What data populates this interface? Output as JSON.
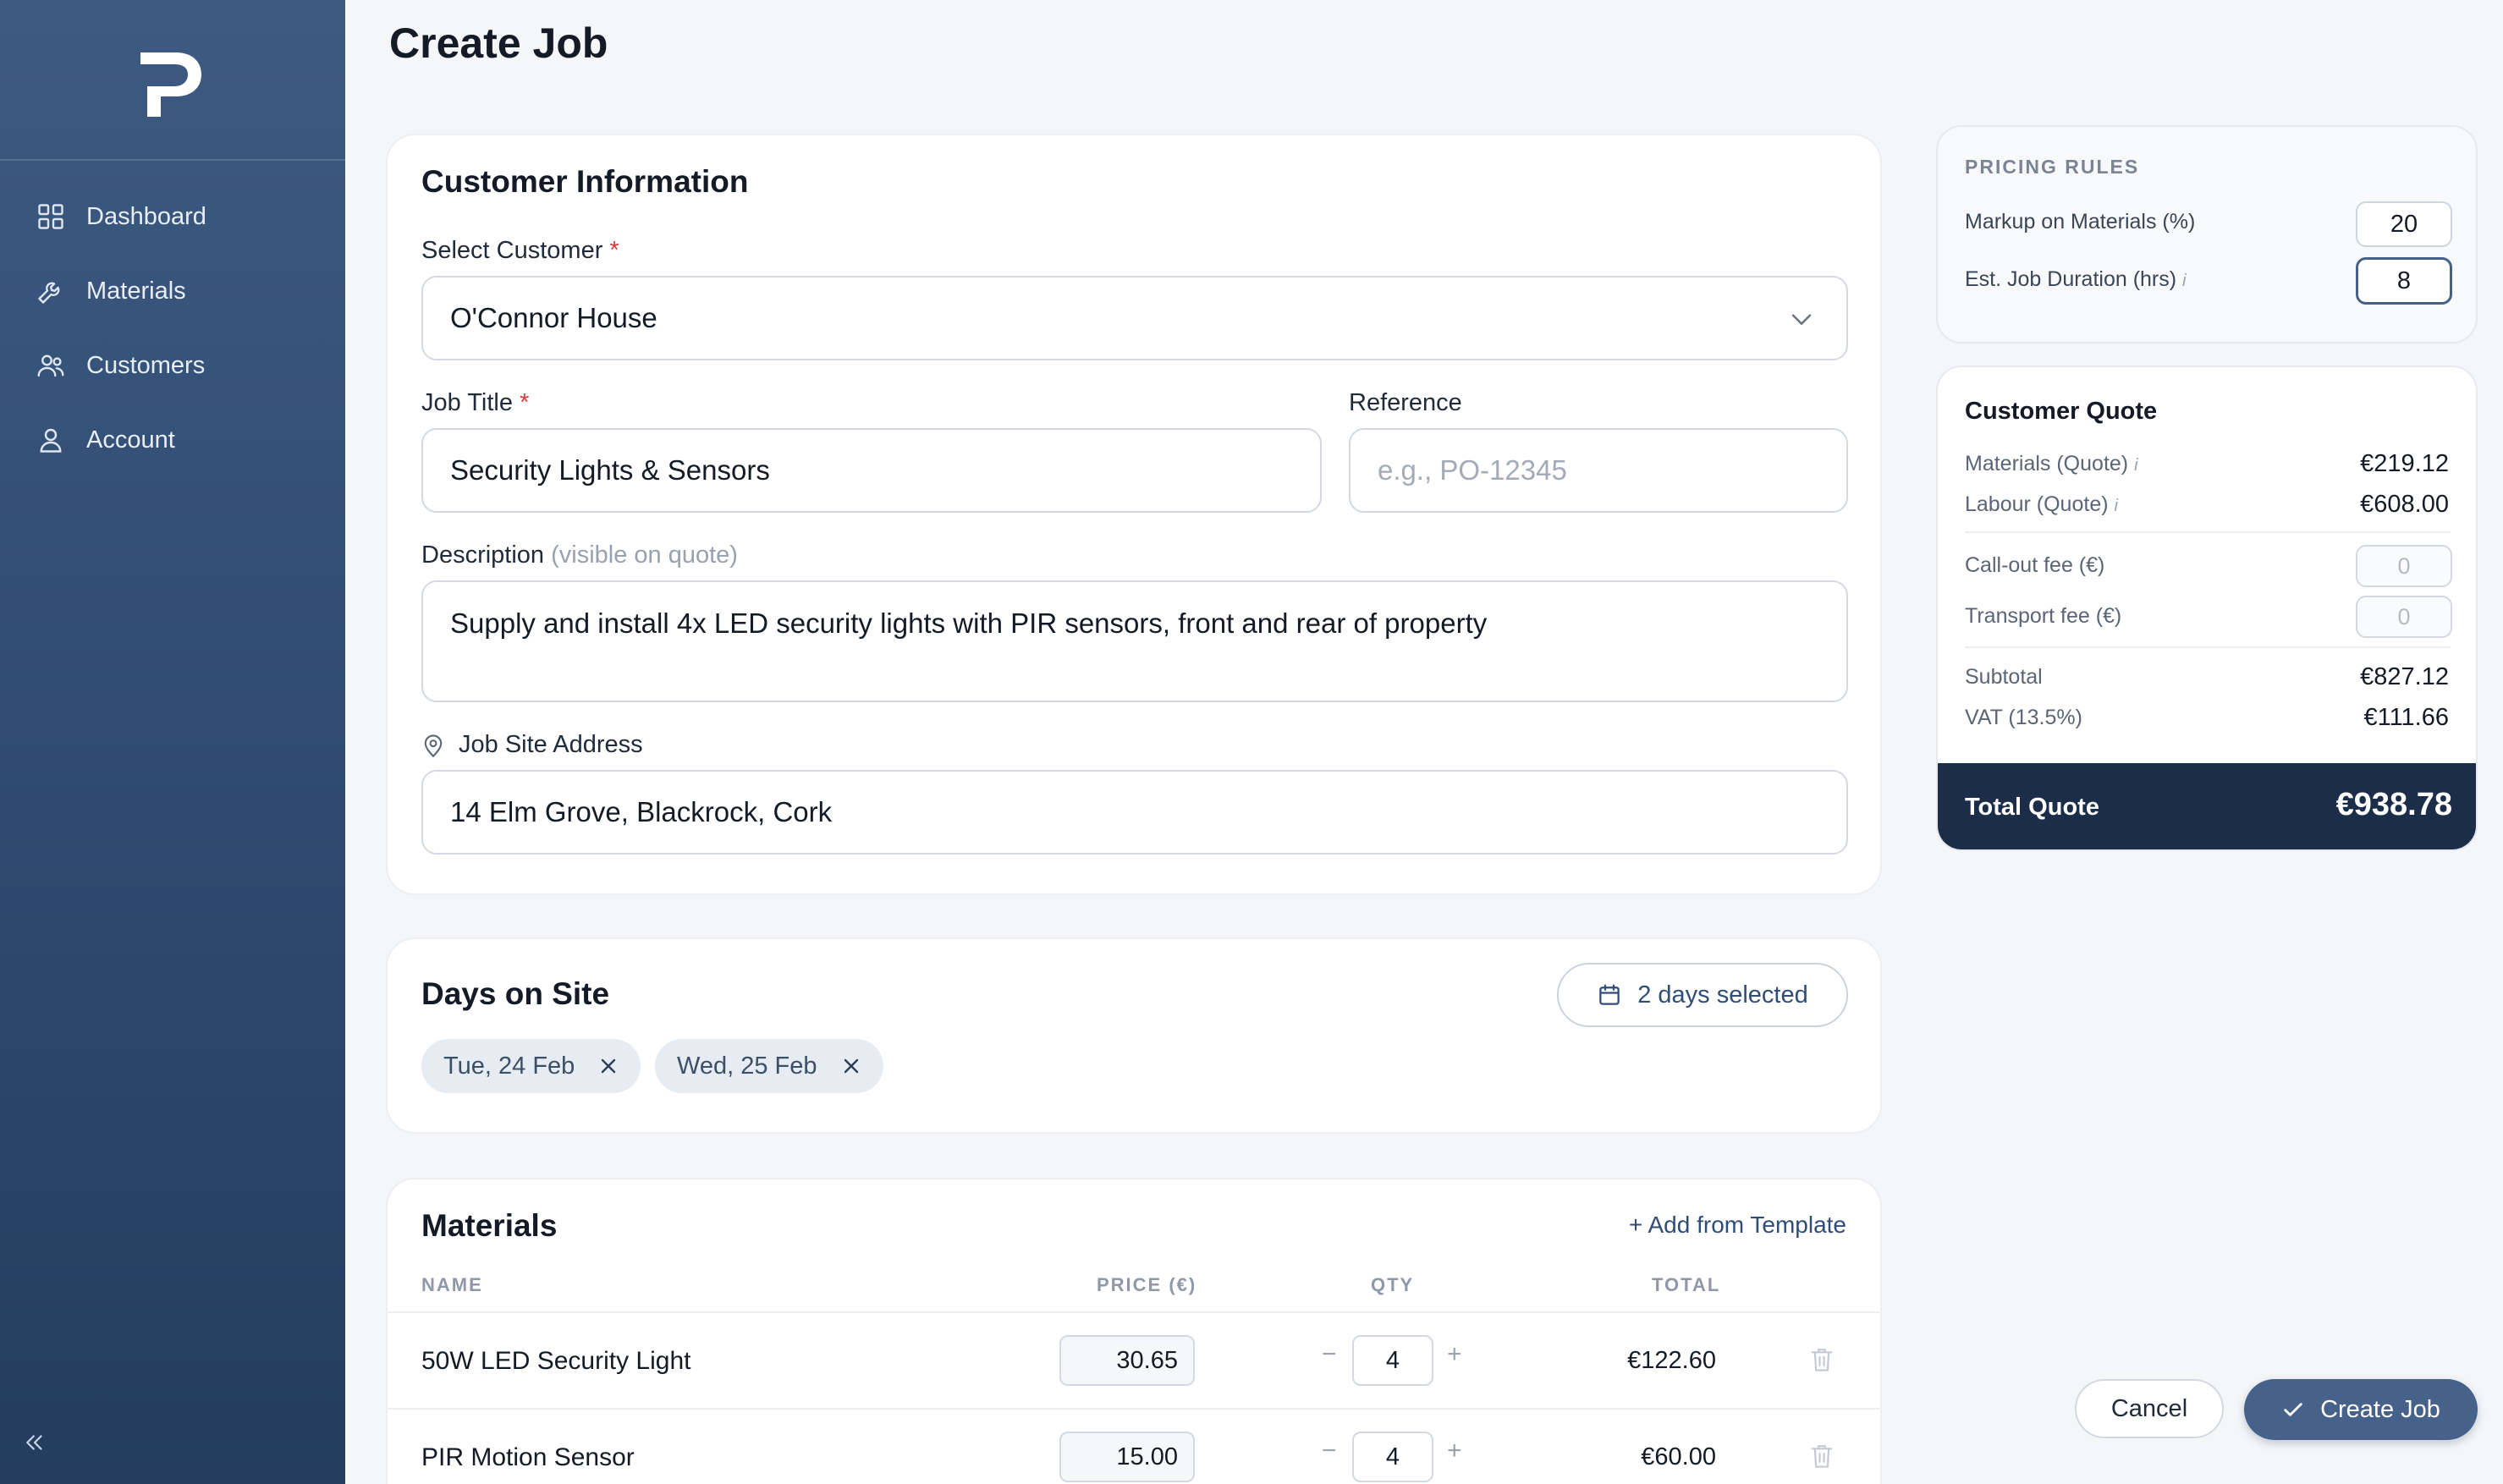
{
  "app": {
    "logo_letter": "P",
    "page_title": "Create Job"
  },
  "sidebar": {
    "items": [
      {
        "label": "Dashboard",
        "icon": "grid-icon"
      },
      {
        "label": "Materials",
        "icon": "wrench-icon"
      },
      {
        "label": "Customers",
        "icon": "users-icon"
      },
      {
        "label": "Account",
        "icon": "user-icon"
      }
    ],
    "collapse_icon": "chevrons-left-icon"
  },
  "customer_info": {
    "title": "Customer Information",
    "select_customer_label": "Select Customer",
    "required_mark": "*",
    "selected_customer": "O'Connor House",
    "job_title_label": "Job Title",
    "job_title_value": "Security Lights & Sensors",
    "reference_label": "Reference",
    "reference_placeholder": "e.g., PO-12345",
    "description_label": "Description",
    "description_hint": "(visible on quote)",
    "description_value": "Supply and install 4x LED security lights with PIR sensors, front and rear of property",
    "address_label": "Job Site Address",
    "address_value": "14 Elm Grove, Blackrock, Cork"
  },
  "days_on_site": {
    "title": "Days on Site",
    "button_label": "2 days selected",
    "days": [
      "Tue, 24 Feb",
      "Wed, 25 Feb"
    ]
  },
  "materials": {
    "title": "Materials",
    "add_template": "+ Add from Template",
    "columns": [
      "NAME",
      "PRICE (€)",
      "QTY",
      "TOTAL"
    ],
    "rows": [
      {
        "name": "50W LED Security Light",
        "price": "30.65",
        "qty": "4",
        "total": "€122.60"
      },
      {
        "name": "PIR Motion Sensor",
        "price": "15.00",
        "qty": "4",
        "total": "€60.00"
      }
    ],
    "minus": "−",
    "plus": "+"
  },
  "pricing_rules": {
    "title": "PRICING RULES",
    "markup_label": "Markup on Materials (%)",
    "markup_value": "20",
    "duration_label": "Est. Job Duration (hrs)",
    "duration_value": "8",
    "info_mark": "i"
  },
  "quote": {
    "title": "Customer Quote",
    "materials_label": "Materials (Quote)",
    "materials_value": "€219.12",
    "labour_label": "Labour (Quote)",
    "labour_value": "€608.00",
    "callout_label": "Call-out fee (€)",
    "callout_value": "0",
    "transport_label": "Transport fee (€)",
    "transport_value": "0",
    "subtotal_label": "Subtotal",
    "subtotal_value": "€827.12",
    "vat_label": "VAT (13.5%)",
    "vat_value": "€111.66",
    "total_label": "Total Quote",
    "total_value": "€938.78"
  },
  "actions": {
    "cancel": "Cancel",
    "create": "Create Job"
  },
  "colors": {
    "sidebar_top": "#3d5a82",
    "sidebar_bottom": "#243d5e",
    "accent": "#46618a",
    "total_bar": "#1c2d49",
    "required": "#d63a3a"
  }
}
